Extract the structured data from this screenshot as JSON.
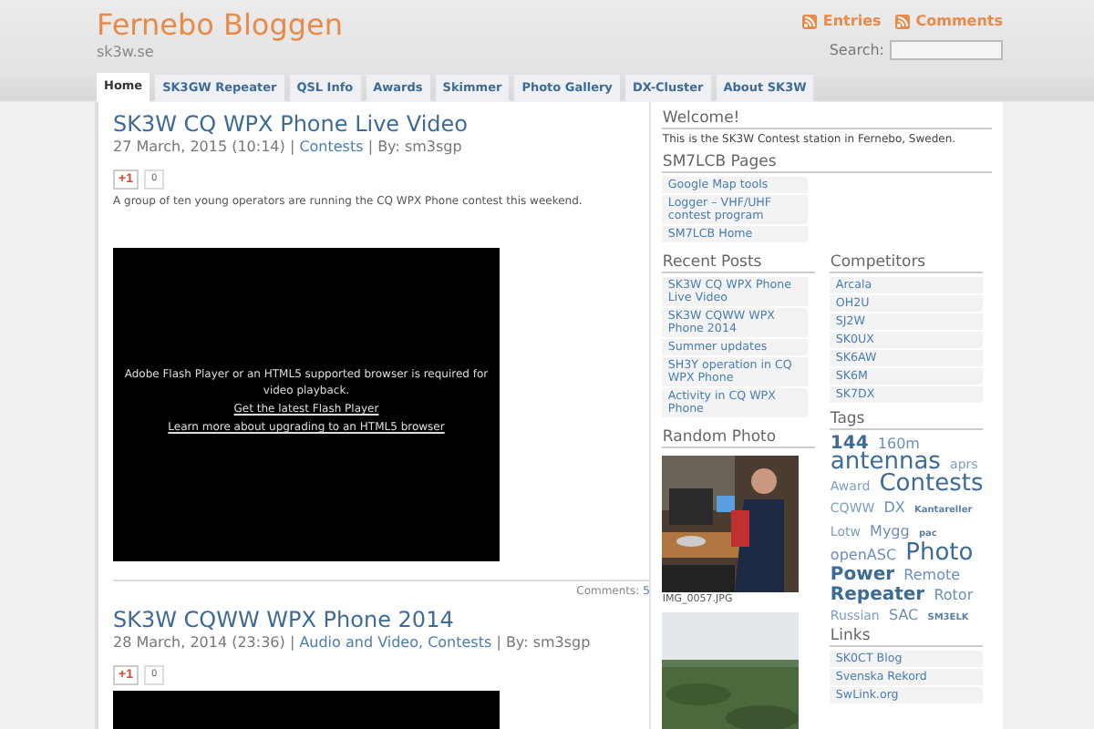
{
  "header": {
    "title": "Fernebo Bloggen",
    "tagline": "sk3w.se",
    "feeds": [
      "Entries",
      "Comments"
    ],
    "search": {
      "label": "Search:"
    }
  },
  "nav": [
    {
      "label": "Home",
      "selected": true
    },
    {
      "label": "SK3GW Repeater",
      "selected": false
    },
    {
      "label": "QSL Info",
      "selected": false
    },
    {
      "label": "Awards",
      "selected": false
    },
    {
      "label": "Skimmer",
      "selected": false
    },
    {
      "label": "Photo Gallery",
      "selected": false
    },
    {
      "label": "DX-Cluster",
      "selected": false
    },
    {
      "label": "About SK3W",
      "selected": false
    }
  ],
  "posts": [
    {
      "title": "SK3W CQ WPX Phone Live Video",
      "date": "27 March, 2015 (10:14) |",
      "categories": "Contests",
      "author": "| By: sm3sgp",
      "plus": "+1",
      "plus_count": "0",
      "excerpt": "A group of ten young operators are running the CQ WPX Phone contest this weekend.",
      "video": {
        "kind": "player",
        "message": "Adobe Flash Player or an HTML5 supported browser is required for video playback.",
        "links": [
          "Get the latest Flash Player",
          "Learn more about upgrading to an HTML5 browser"
        ]
      },
      "comments_label": "Comments:",
      "comments": "5"
    },
    {
      "title": "SK3W CQWW WPX Phone 2014",
      "date": "28 March, 2014 (23:36) |",
      "categories": "Audio and Video, Contests",
      "author": "| By: sm3sgp",
      "plus": "+1",
      "plus_count": "0",
      "video": {
        "kind": "player"
      }
    }
  ],
  "sidebar": {
    "welcome": {
      "title": "Welcome!",
      "text": "This is the SK3W Contest station in Fernebo, Sweden."
    },
    "pages": {
      "title": "SM7LCB Pages",
      "items": [
        "Google Map tools",
        "Logger – VHF/UHF contest program",
        "SM7LCB Home"
      ]
    },
    "recent": {
      "title": "Recent Posts",
      "items": [
        "SK3W CQ WPX Phone Live Video",
        "SK3W CQWW WPX Phone 2014",
        "Summer updates",
        "SH3Y operation in CQ WPX Phone",
        "Activity in CQ WPX Phone"
      ]
    },
    "photo": {
      "title": "Random Photo",
      "caption": "IMG_0057.JPG"
    },
    "competitors": {
      "title": "Competitors",
      "items": [
        "Arcala",
        "OH2U",
        "SJ2W",
        "SK0UX",
        "SK6AW",
        "SK6M",
        "SK7DX"
      ]
    },
    "tags": {
      "title": "Tags",
      "items": [
        {
          "label": "144",
          "kind": "large"
        },
        {
          "label": "160m",
          "kind": "medium"
        },
        {
          "label": "antennas",
          "kind": "huge"
        },
        {
          "label": "aprs",
          "kind": "small"
        },
        {
          "label": "Award",
          "kind": "small"
        },
        {
          "label": "Contests",
          "kind": "huge"
        },
        {
          "label": "CQWW",
          "kind": "small"
        },
        {
          "label": "DX",
          "kind": "medium"
        },
        {
          "label": "Kantareller",
          "kind": "tiny"
        },
        {
          "label": "Lotw",
          "kind": "small"
        },
        {
          "label": "Mygg",
          "kind": "medium"
        },
        {
          "label": "pac",
          "kind": "tiny"
        },
        {
          "label": "openASC",
          "kind": "medium"
        },
        {
          "label": "Photo",
          "kind": "huge"
        },
        {
          "label": "Power",
          "kind": "large"
        },
        {
          "label": "Remote",
          "kind": "medium"
        },
        {
          "label": "Repeater",
          "kind": "large"
        },
        {
          "label": "Rotor",
          "kind": "medium"
        },
        {
          "label": "Russian",
          "kind": "small"
        },
        {
          "label": "SAC",
          "kind": "medium"
        },
        {
          "label": "SM3ELK",
          "kind": "tiny"
        }
      ]
    },
    "links": {
      "title": "Links",
      "items": [
        "SK0CT Blog",
        "Svenska Rekord",
        "SwLink.org"
      ]
    }
  }
}
